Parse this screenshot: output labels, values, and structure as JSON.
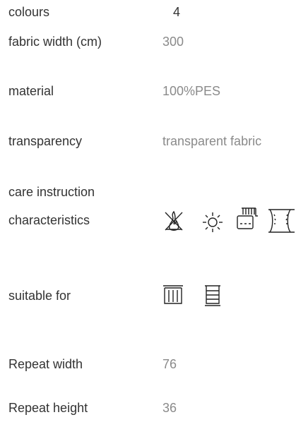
{
  "specs": {
    "colours": {
      "label": "colours",
      "value": "4"
    },
    "fabric_width": {
      "label": "fabric width (cm)",
      "value": "300"
    },
    "material": {
      "label": "material",
      "value": "100%PES"
    },
    "transparency": {
      "label": "transparency",
      "value": "transparent fabric"
    },
    "care_instruction": {
      "label": "care instruction"
    },
    "characteristics": {
      "label": "characteristics",
      "icons": [
        "flame-retardant-icon",
        "lightfast-sun-icon",
        "curtain-washable-icon",
        "fabric-roll-icon"
      ]
    },
    "suitable_for": {
      "label": "suitable for",
      "icons": [
        "curtain-icon",
        "blind-panel-icon"
      ]
    },
    "repeat_width": {
      "label": "Repeat width",
      "value": "76"
    },
    "repeat_height": {
      "label": "Repeat height",
      "value": "36"
    }
  }
}
